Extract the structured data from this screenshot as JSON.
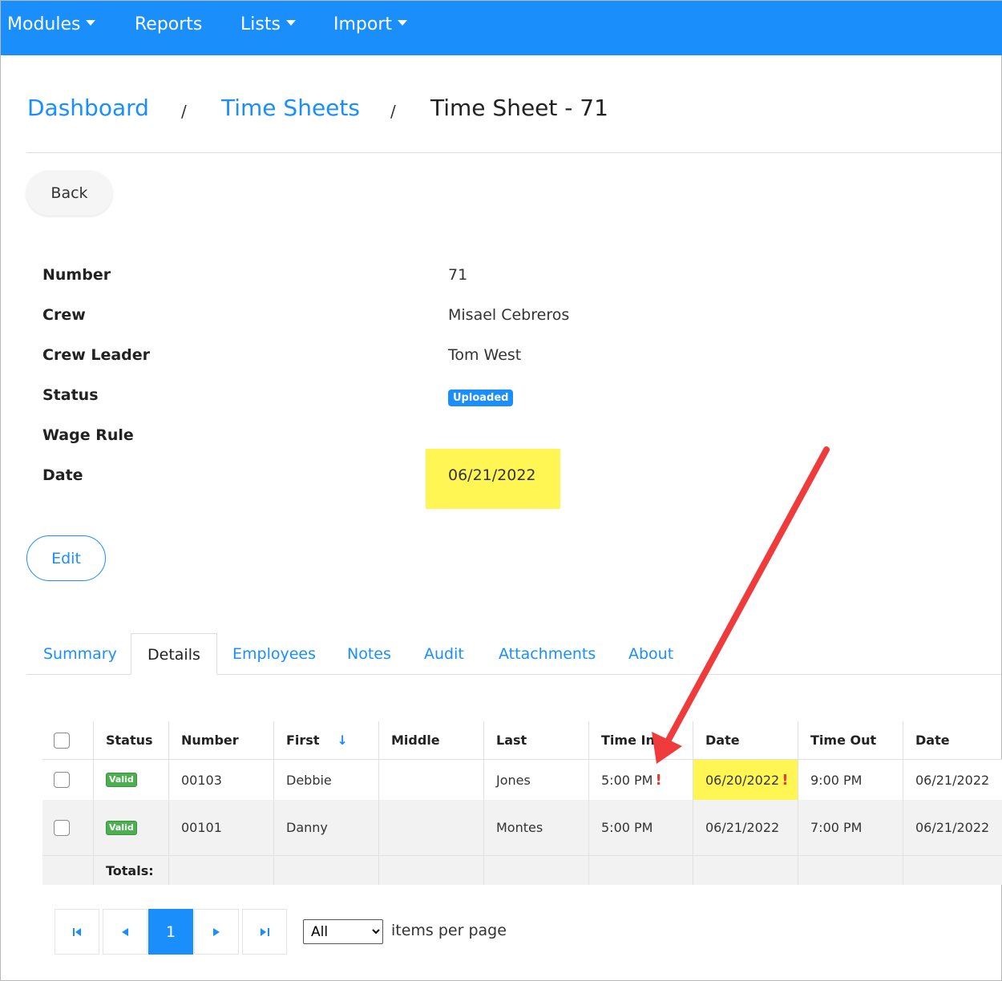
{
  "nav": {
    "items": [
      {
        "label": "Modules",
        "dropdown": true
      },
      {
        "label": "Reports",
        "dropdown": false
      },
      {
        "label": "Lists",
        "dropdown": true
      },
      {
        "label": "Import",
        "dropdown": true
      }
    ],
    "color": "#1a8ffb"
  },
  "breadcrumb": {
    "items": [
      "Dashboard",
      "Time Sheets"
    ],
    "separator": "/",
    "current": "Time Sheet - 71"
  },
  "actions": {
    "back_label": "Back",
    "edit_label": "Edit"
  },
  "fields": [
    {
      "label": "Number",
      "value": "71"
    },
    {
      "label": "Crew",
      "value": "Misael Cebreros"
    },
    {
      "label": "Crew Leader",
      "value": "Tom West"
    },
    {
      "label": "Status",
      "value": "Uploaded"
    },
    {
      "label": "Wage Rule",
      "value": ""
    },
    {
      "label": "Date",
      "value": "06/21/2022"
    }
  ],
  "tabs": [
    {
      "label": "Summary",
      "active": false
    },
    {
      "label": "Details",
      "active": true
    },
    {
      "label": "Employees",
      "active": false
    },
    {
      "label": "Notes",
      "active": false
    },
    {
      "label": "Audit",
      "active": false
    },
    {
      "label": "Attachments",
      "active": false
    },
    {
      "label": "About",
      "active": false
    }
  ],
  "table": {
    "columns": [
      "Status",
      "Number",
      "First",
      "Middle",
      "Last",
      "Time In",
      "Date",
      "Time Out",
      "Date"
    ],
    "sorted_column_icon": "arrow-down-icon",
    "rows": [
      {
        "status": "Valid",
        "number": "00103",
        "first": "Debbie",
        "middle": "",
        "last": "Jones",
        "time_in": "5:00 PM",
        "date_in": "06/20/2022",
        "time_out": "9:00 PM",
        "date_out": "06/21/2022",
        "warn_mark": "!"
      },
      {
        "status": "Valid",
        "number": "00101",
        "first": "Danny",
        "middle": "",
        "last": "Montes",
        "time_in": "5:00 PM",
        "date_in": "06/21/2022",
        "time_out": "7:00 PM",
        "date_out": "06/21/2022"
      }
    ],
    "totals_label": "Totals:"
  },
  "pager": {
    "current_page": "1",
    "first_icon": "first-page-icon",
    "prev_icon": "prev-page-icon",
    "next_icon": "next-page-icon",
    "last_icon": "last-page-icon",
    "per_page_value": "All",
    "per_page_label": "items per page"
  },
  "annotation": {
    "arrow_color": "#ef3b3b",
    "highlight_color": "#fff654"
  }
}
